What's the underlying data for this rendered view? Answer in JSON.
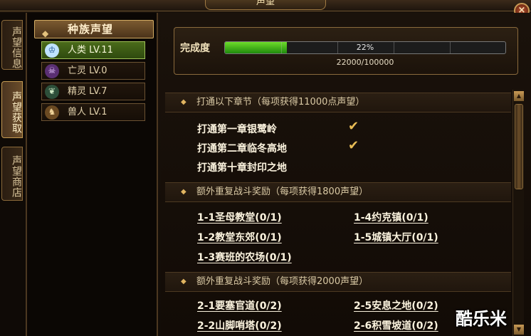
{
  "window": {
    "title": "声望",
    "close_label": "×"
  },
  "side_tabs": [
    {
      "label": "声望信息",
      "active": false
    },
    {
      "label": "声望获取",
      "active": true
    },
    {
      "label": "声望商店",
      "active": false
    }
  ],
  "race_panel": {
    "header": "种族声望",
    "races": [
      {
        "label": "人类 LV.11",
        "icon": "human-crest-icon",
        "active": true
      },
      {
        "label": "亡灵 LV.0",
        "icon": "undead-crest-icon",
        "active": false
      },
      {
        "label": "精灵 LV.7",
        "icon": "elf-crest-icon",
        "active": false
      },
      {
        "label": "兽人 LV.1",
        "icon": "orc-crest-icon",
        "active": false
      }
    ]
  },
  "progress": {
    "label": "完成度",
    "percent_text": "22%",
    "percent_value": 22,
    "count_text": "22000/100000"
  },
  "sections": [
    {
      "title": "打通以下章节（每项获得11000点声望）",
      "tasks": [
        {
          "label": "打通第一章银鹭岭",
          "done": true
        },
        {
          "label": "打通第二章临冬高地",
          "done": true
        },
        {
          "label": "打通第十章封印之地",
          "done": false
        }
      ]
    },
    {
      "title": "额外重复战斗奖励（每项获得1800声望）",
      "links": [
        {
          "label": "1-1圣母教堂(0/1)"
        },
        {
          "label": "1-4约克镇(0/1)"
        },
        {
          "label": "1-2教堂东郊(0/1)"
        },
        {
          "label": "1-5城镇大厅(0/1)"
        },
        {
          "label": "1-3赛班的农场(0/1)"
        }
      ]
    },
    {
      "title": "额外重复战斗奖励（每项获得2000声望）",
      "links": [
        {
          "label": "2-1要塞官道(0/2)"
        },
        {
          "label": "2-5安息之地(0/2)"
        },
        {
          "label": "2-2山脚哨塔(0/2)"
        },
        {
          "label": "2-6积雪坡道(0/2)"
        }
      ]
    }
  ],
  "watermark": "酷乐米",
  "colors": {
    "accent_gold": "#d2ab63",
    "active_green": "#4a6b1a",
    "progress_green": "#6ddc2a",
    "check_gold": "#e8bc55"
  }
}
